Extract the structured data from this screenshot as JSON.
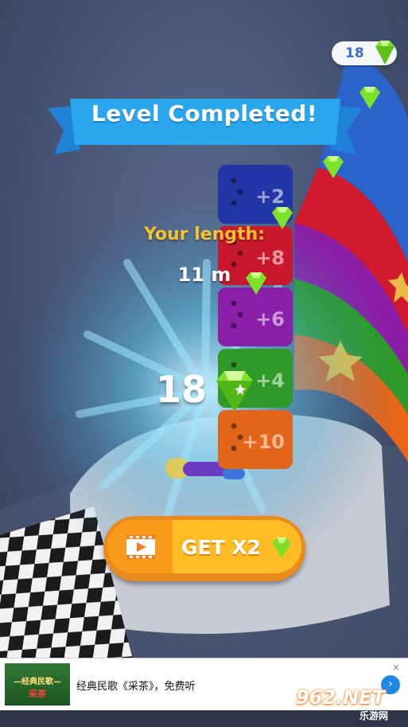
{
  "hud": {
    "gem_count": "18"
  },
  "banner": {
    "title": "Level Completed!"
  },
  "result": {
    "length_label": "Your length:",
    "length_value": "11 m"
  },
  "reward": {
    "amount": "18"
  },
  "tower": {
    "blocks": [
      {
        "label": "+2",
        "color": "#2336a8"
      },
      {
        "label": "+8",
        "color": "#c8182d"
      },
      {
        "label": "+6",
        "color": "#8a1fa8"
      },
      {
        "label": "+4",
        "color": "#2f9a28"
      },
      {
        "label": "+10",
        "color": "#e2651a"
      }
    ]
  },
  "actions": {
    "get_x2_label": "GET X2"
  },
  "ad": {
    "thumb_caption": "—经典民歌—",
    "thumb_sub": "采茶",
    "title": "经典民歌《采茶》，免费听",
    "close": "×",
    "go": "›"
  },
  "watermark": {
    "brand": "962.NET",
    "sub": "乐游网"
  },
  "colors": {
    "gem": "#7ee02a",
    "banner": "#2aa6ef",
    "button": "#ffbc25"
  }
}
